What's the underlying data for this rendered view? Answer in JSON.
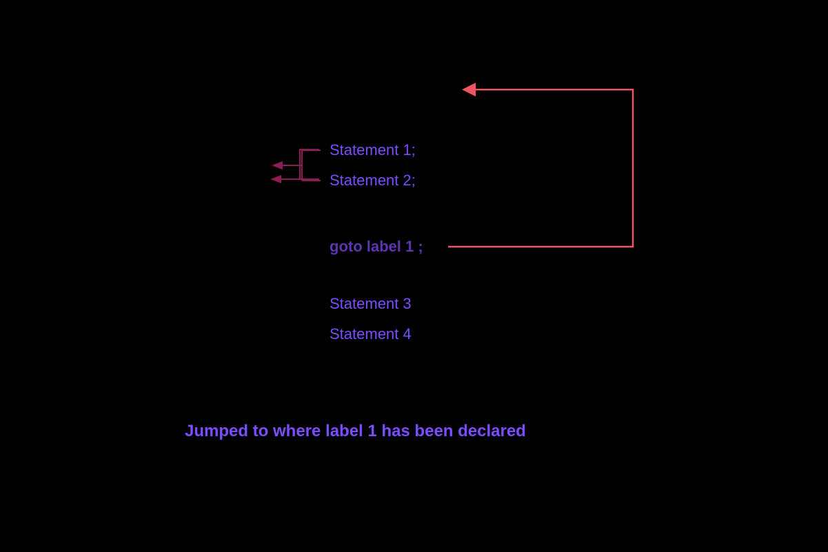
{
  "diagram": {
    "lines": {
      "stmt1": "Statement 1;",
      "stmt2": "Statement 2;",
      "goto": "goto label 1 ;",
      "stmt3": "Statement 3",
      "stmt4": "Statement 4"
    },
    "caption": "Jumped to where label 1 has been declared",
    "colors": {
      "loopArrow": "#F05566",
      "braceArrow": "#8E1C56",
      "codeText": "#7C4DFF",
      "gotoText": "#5E35B1"
    }
  }
}
